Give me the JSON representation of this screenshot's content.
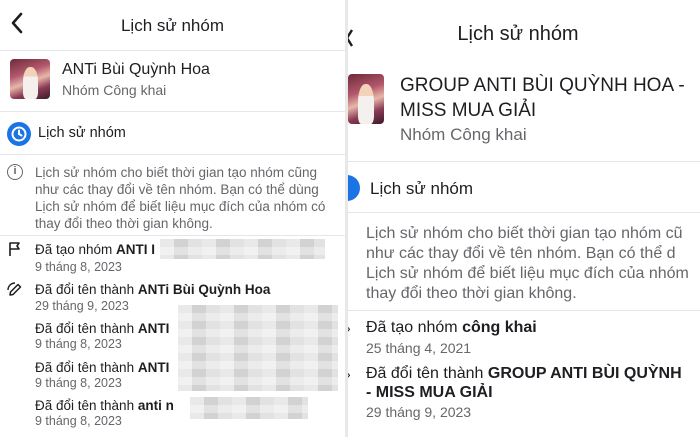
{
  "left": {
    "title": "Lịch sử nhóm",
    "group_name": "ANTi Bùi Quỳnh Hoa",
    "group_type": "Nhóm Công khai",
    "section_title": "Lịch sử nhóm",
    "description_lines": [
      "Lịch sử nhóm cho biết thời gian tạo nhóm cũng",
      "như các thay đổi về tên nhóm. Bạn có thể dùng",
      "Lịch sử nhóm để biết liệu mục đích của nhóm có",
      "thay đổi theo thời gian không."
    ],
    "events": [
      {
        "prefix": "Đã tạo nhóm ",
        "bold": "ANTI I",
        "date": "9 tháng 8, 2023"
      },
      {
        "prefix": "Đã đổi tên thành ",
        "bold": "ANTi Bùi Quỳnh Hoa",
        "date": "29 tháng 9, 2023"
      },
      {
        "prefix": "Đã đổi tên thành ",
        "bold": "ANTI",
        "date": "9 tháng 8, 2023"
      },
      {
        "prefix": "Đã đổi tên thành ",
        "bold": "ANTI",
        "date": "9 tháng 8, 2023"
      },
      {
        "prefix": "Đã đổi tên thành ",
        "bold": "anti n",
        "date": "9 tháng 8, 2023"
      }
    ]
  },
  "right": {
    "title": "Lịch sử nhóm",
    "group_name_line1": "GROUP ANTI BÙI QUỲNH HOA -",
    "group_name_line2": "MISS MUA GIẢI",
    "group_type": "Nhóm Công khai",
    "section_title": "Lịch sử nhóm",
    "description_lines": [
      "Lịch sử nhóm cho biết thời gian tạo nhóm cũ",
      "như các thay đổi về tên nhóm. Bạn có thể d",
      "Lịch sử nhóm để biết liệu mục đích của nhóm",
      "thay đổi theo thời gian không."
    ],
    "events": [
      {
        "prefix": "Đã tạo nhóm ",
        "bold": "công khai",
        "bold2": "",
        "date": "25 tháng 4, 2021"
      },
      {
        "prefix": "Đã đổi tên thành ",
        "bold": "GROUP ANTI BÙI QUỲNH",
        "bold2": "- MISS MUA GIẢI",
        "date": "29 tháng 9, 2023"
      }
    ]
  },
  "colors": {
    "accent": "#1b74e4",
    "muted": "#65676b",
    "text": "#1c1e21"
  },
  "icons": [
    "back-arrow-icon",
    "clock-icon",
    "info-icon",
    "flag-icon",
    "edit-icon",
    "chevron-icon"
  ]
}
